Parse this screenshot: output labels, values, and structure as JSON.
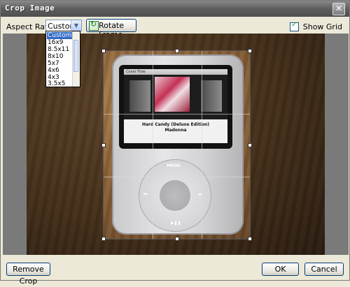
{
  "window": {
    "title": "Crop Image",
    "close_icon": "close-icon"
  },
  "toolbar": {
    "aspect_ratio_label": "Aspect Ratio:",
    "aspect_ratio_value": "Custom",
    "rotate_label": "Rotate Frame",
    "show_grid_label": "Show Grid",
    "show_grid_checked": true
  },
  "dropdown": {
    "options": [
      "Custom",
      "16x9",
      "8.5x11",
      "8x10",
      "5x7",
      "4x6",
      "4x3",
      "3.5x5"
    ],
    "selected": "Custom"
  },
  "photo": {
    "screen_header": "Cover Flow",
    "album": "Hard Candy (Deluxe Edition)",
    "artist": "Madonna",
    "wheel_top": "MENU"
  },
  "footer": {
    "remove_crop_label": "Remove Crop",
    "ok_label": "OK",
    "cancel_label": "Cancel"
  },
  "colors": {
    "selection": "#316ac5",
    "button_border": "#003c74",
    "window_bg": "#ece9d8"
  }
}
